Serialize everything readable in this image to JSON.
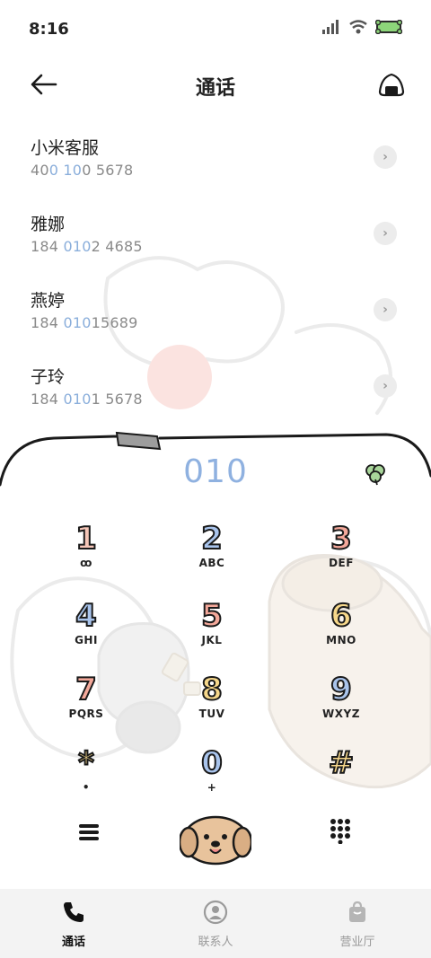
{
  "status_bar": {
    "time": "8:16"
  },
  "header": {
    "title": "通话"
  },
  "calls": [
    {
      "name": "小米客服",
      "number_pre": "40",
      "number_hl": "0 10",
      "number_post": "0 5678"
    },
    {
      "name": "雅娜",
      "number_pre": "184 ",
      "number_hl": "010",
      "number_post": "2 4685"
    },
    {
      "name": "燕婷",
      "number_pre": "184 ",
      "number_hl": "010",
      "number_post": "15689"
    },
    {
      "name": "子玲",
      "number_pre": "184 ",
      "number_hl": "010",
      "number_post": "1 5678"
    }
  ],
  "dialer": {
    "display": "010",
    "keys": [
      {
        "digit": "1",
        "letters": "ꝏ",
        "color": "#f6c6b8"
      },
      {
        "digit": "2",
        "letters": "ABC",
        "color": "#a9c4ec"
      },
      {
        "digit": "3",
        "letters": "DEF",
        "color": "#f3a89a"
      },
      {
        "digit": "4",
        "letters": "GHI",
        "color": "#a9c4ec"
      },
      {
        "digit": "5",
        "letters": "JKL",
        "color": "#f3a89a"
      },
      {
        "digit": "6",
        "letters": "MNO",
        "color": "#f6d78a"
      },
      {
        "digit": "7",
        "letters": "PQRS",
        "color": "#f3a89a"
      },
      {
        "digit": "8",
        "letters": "TUV",
        "color": "#f6d78a"
      },
      {
        "digit": "9",
        "letters": "WXYZ",
        "color": "#a9c4ec"
      },
      {
        "digit": "*",
        "letters": "•",
        "color": "#f6d78a"
      },
      {
        "digit": "0",
        "letters": "+",
        "color": "#a9c4ec"
      },
      {
        "digit": "#",
        "letters": "",
        "color": "#f6d78a"
      }
    ]
  },
  "tabs": [
    {
      "label": "通话",
      "icon": "phone-icon",
      "active": true
    },
    {
      "label": "联系人",
      "icon": "contact-icon",
      "active": false
    },
    {
      "label": "营业厅",
      "icon": "bag-icon",
      "active": false
    }
  ],
  "colors": {
    "highlight": "#8aaedb",
    "display": "#8fb1e0"
  }
}
